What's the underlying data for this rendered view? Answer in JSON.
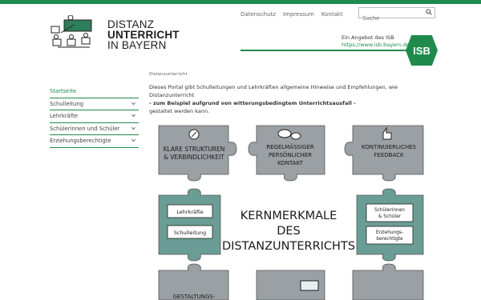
{
  "header": {
    "logo_line1": "DISTANZ",
    "logo_line2": "UNTERRICHT",
    "logo_line3": "IN BAYERN",
    "nav": [
      "Datenschutz",
      "Impressum",
      "Kontakt"
    ],
    "search_placeholder": "Suche",
    "isb_caption": "Ein Angebot des ISB",
    "isb_url": "https://www.isb.bayern.de",
    "isb_badge": "ISB"
  },
  "breadcrumb": "Distanzunterricht",
  "sidebar": {
    "items": [
      {
        "label": "Startseite",
        "expandable": false
      },
      {
        "label": "Schulleitung",
        "expandable": true
      },
      {
        "label": "Lehrkräfte",
        "expandable": true
      },
      {
        "label": "Schülerinnen und Schüler",
        "expandable": true
      },
      {
        "label": "Erziehungsberechtigte",
        "expandable": true
      }
    ]
  },
  "intro": {
    "line1": "Dieses Portal gibt Schulleitungen und Lehrkräften allgemeine Hinweise und Empfehlungen, wie Distanzunterricht",
    "line2": "- zum Beispiel aufgrund von witterungsbedingtem Unterrichtsausfall -",
    "line3": "gestaltet werden kann."
  },
  "graphic": {
    "piece_structure": [
      "KLARE STRUKTUREN",
      "& VERBINDLICHKEIT"
    ],
    "piece_contact": [
      "REGELMÄSSIGER",
      "PERSÖNLICHER",
      "KONTAKT"
    ],
    "piece_feedback": [
      "KONTINUIERLICHES",
      "FEEDBACK"
    ],
    "center_title": [
      "KERNMERKMALE",
      "DES",
      "DISTANZUNTERRICHTS"
    ],
    "box_teachers": "Lehrkräfte",
    "box_principal": "Schulleitung",
    "box_students": [
      "Schülerinnen",
      "& Schüler"
    ],
    "box_parents": [
      "Erziehungs-",
      "berechtigte"
    ],
    "piece_bottom_left": "GESTALTUNGS-",
    "colors": {
      "gray": "#9aa0a3",
      "teal": "#6a9d95",
      "green": "#1f8a4c"
    }
  }
}
